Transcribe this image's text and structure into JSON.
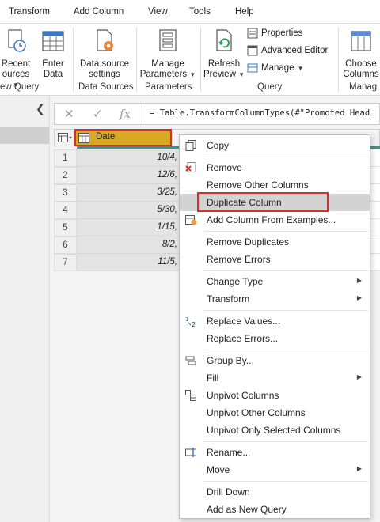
{
  "tabs": [
    "Transform",
    "Add Column",
    "View",
    "Tools",
    "Help"
  ],
  "ribbon": {
    "recent_sources": {
      "line1": "Recent",
      "line2": "ources"
    },
    "enter_data": {
      "line1": "Enter",
      "line2": "Data"
    },
    "new_query_group": "ew Query",
    "data_source_settings": {
      "line1": "Data source",
      "line2": "settings"
    },
    "data_sources_group": "Data Sources",
    "manage_parameters": {
      "line1": "Manage",
      "line2": "Parameters"
    },
    "parameters_group": "Parameters",
    "refresh_preview": {
      "line1": "Refresh",
      "line2": "Preview"
    },
    "properties": "Properties",
    "advanced_editor": "Advanced Editor",
    "manage": "Manage",
    "query_group": "Query",
    "choose_columns": {
      "line1": "Choose",
      "line2": "Columns"
    },
    "manage_group": "Manag"
  },
  "formula": {
    "cancel": "✕",
    "commit": "✓",
    "fx": "fx",
    "text": "= Table.TransformColumnTypes(#\"Promoted Head"
  },
  "grid": {
    "column_header": "Date",
    "rows": [
      {
        "num": "1",
        "date": "10/4,"
      },
      {
        "num": "2",
        "date": "12/6,"
      },
      {
        "num": "3",
        "date": "3/25,"
      },
      {
        "num": "4",
        "date": "5/30,"
      },
      {
        "num": "5",
        "date": "1/15,"
      },
      {
        "num": "6",
        "date": "8/2,"
      },
      {
        "num": "7",
        "date": "11/5,"
      }
    ]
  },
  "context_menu": {
    "copy": "Copy",
    "remove": "Remove",
    "remove_other_columns": "Remove Other Columns",
    "duplicate_column": "Duplicate Column",
    "add_column_from_examples": "Add Column From Examples...",
    "remove_duplicates": "Remove Duplicates",
    "remove_errors": "Remove Errors",
    "change_type": "Change Type",
    "transform": "Transform",
    "replace_values": "Replace Values...",
    "replace_errors": "Replace Errors...",
    "group_by": "Group By...",
    "fill": "Fill",
    "unpivot_columns": "Unpivot Columns",
    "unpivot_other_columns": "Unpivot Other Columns",
    "unpivot_only_selected_columns": "Unpivot Only Selected Columns",
    "rename": "Rename...",
    "move": "Move",
    "drill_down": "Drill Down",
    "add_as_new_query": "Add as New Query"
  },
  "colors": {
    "accent_teal": "#15a396",
    "date_header": "#d9a925",
    "highlight_border": "#d32f2f",
    "menu_hover": "#d3d3d3"
  }
}
